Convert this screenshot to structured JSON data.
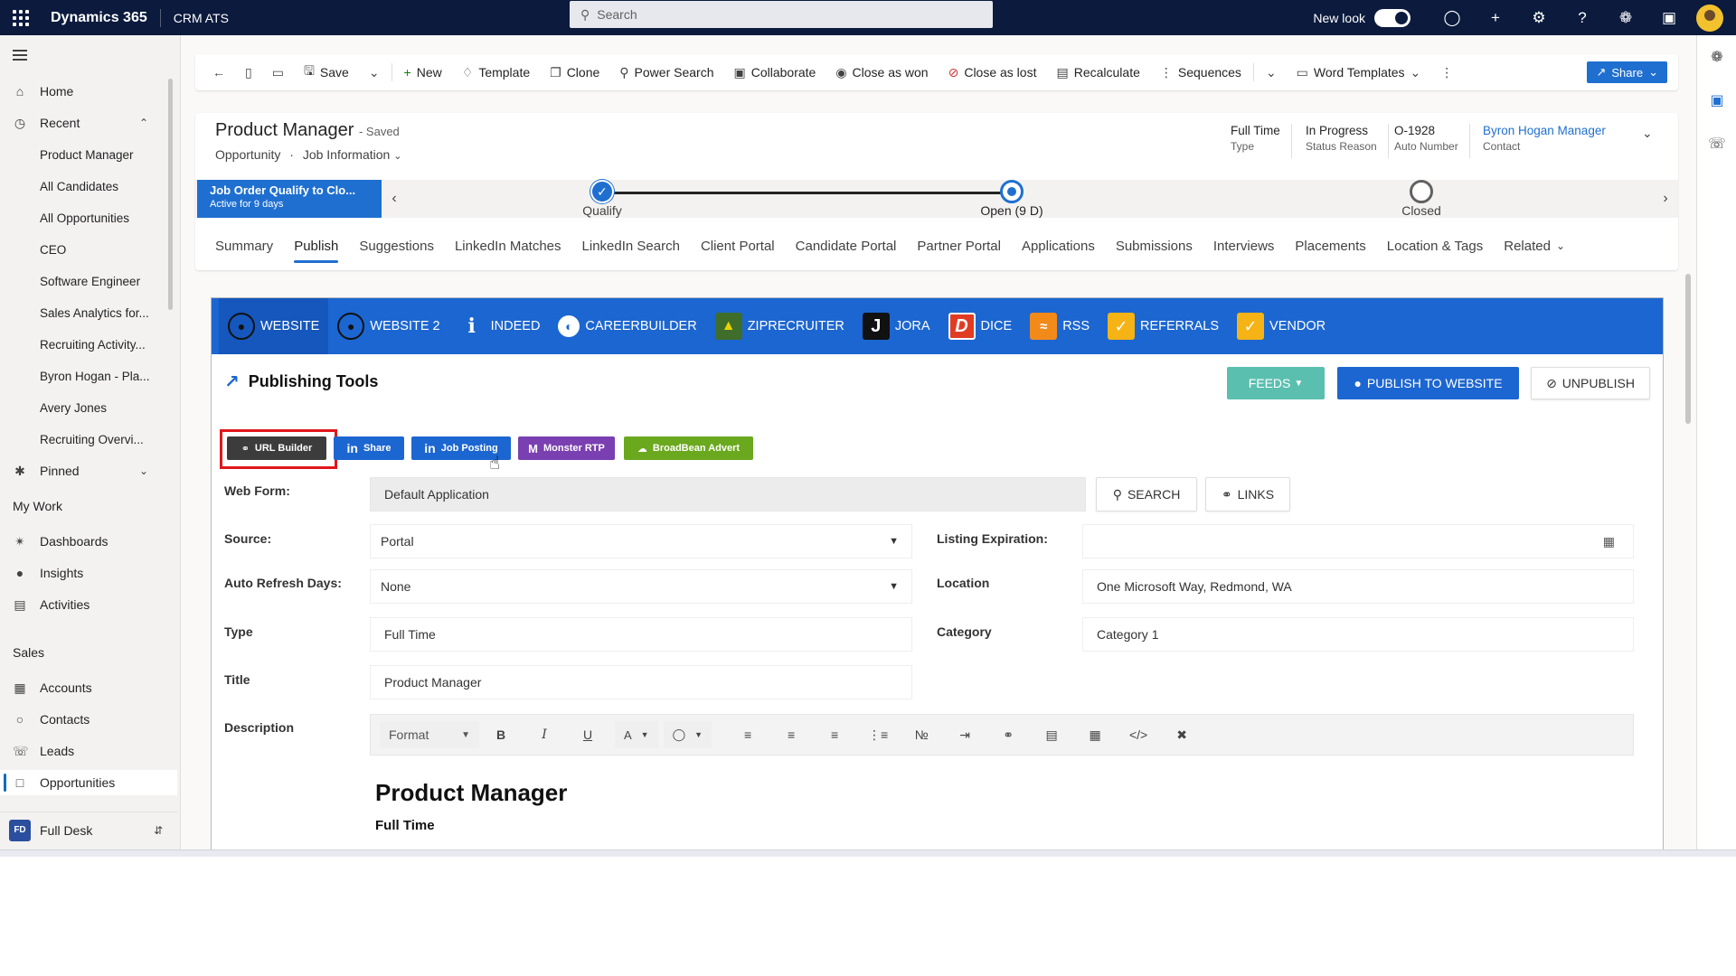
{
  "topbar": {
    "app_name": "Dynamics 365",
    "app_sub": "CRM ATS",
    "search_placeholder": "Search",
    "new_look_label": "New look"
  },
  "nav": {
    "home": "Home",
    "recent": "Recent",
    "recent_items": [
      "Product Manager",
      "All Candidates",
      "All Opportunities",
      "CEO",
      "Software Engineer",
      "Sales Analytics for...",
      "Recruiting Activity...",
      "Byron Hogan - Pla...",
      "Avery Jones",
      "Recruiting Overvi..."
    ],
    "pinned": "Pinned",
    "my_work": "My Work",
    "dashboards": "Dashboards",
    "insights": "Insights",
    "activities": "Activities",
    "sales": "Sales",
    "accounts": "Accounts",
    "contacts": "Contacts",
    "leads": "Leads",
    "opportunities": "Opportunities",
    "area_badge": "FD",
    "area_name": "Full Desk"
  },
  "commands": {
    "save": "Save",
    "new": "New",
    "template": "Template",
    "clone": "Clone",
    "power_search": "Power Search",
    "collaborate": "Collaborate",
    "close_won": "Close as won",
    "close_lost": "Close as lost",
    "recalculate": "Recalculate",
    "sequences": "Sequences",
    "word_templates": "Word Templates",
    "share": "Share"
  },
  "record": {
    "title": "Product Manager",
    "saved": "- Saved",
    "entity": "Opportunity",
    "form": "Job Information",
    "fields": [
      {
        "value": "Full Time",
        "label": "Type"
      },
      {
        "value": "In Progress",
        "label": "Status Reason"
      },
      {
        "value": "O-1928",
        "label": "Auto Number"
      },
      {
        "value": "Byron Hogan Manager",
        "label": "Contact"
      }
    ]
  },
  "bpf": {
    "active_title": "Job Order Qualify to Clo...",
    "active_sub": "Active for 9 days",
    "stages": [
      {
        "name": "Qualify",
        "state": "done"
      },
      {
        "name": "Open  (9 D)",
        "state": "current"
      },
      {
        "name": "Closed",
        "state": "future"
      }
    ]
  },
  "tabs": [
    "Summary",
    "Publish",
    "Suggestions",
    "LinkedIn Matches",
    "LinkedIn Search",
    "Client Portal",
    "Candidate Portal",
    "Partner Portal",
    "Applications",
    "Submissions",
    "Interviews",
    "Placements",
    "Location & Tags",
    "Related"
  ],
  "active_tab": "Publish",
  "channels": [
    "WEBSITE",
    "WEBSITE 2",
    "INDEED",
    "CAREERBUILDER",
    "ZIPRECRUITER",
    "JORA",
    "DICE",
    "RSS",
    "REFERRALS",
    "VENDOR"
  ],
  "publishing": {
    "title": "Publishing Tools",
    "feeds": "FEEDS",
    "publish": "PUBLISH TO WEBSITE",
    "unpublish": "UNPUBLISH",
    "tools": {
      "url_builder": "URL Builder",
      "share": "Share",
      "job_posting": "Job Posting",
      "monster": "Monster RTP",
      "broadbean": "BroadBean Advert"
    },
    "search": "SEARCH",
    "links": "LINKS"
  },
  "form": {
    "web_form_label": "Web Form:",
    "web_form_value": "Default Application",
    "source_label": "Source:",
    "source_value": "Portal",
    "listing_exp_label": "Listing Expiration:",
    "auto_refresh_label": "Auto Refresh Days:",
    "auto_refresh_value": "None",
    "location_label": "Location",
    "location_value": "One Microsoft Way, Redmond, WA",
    "type_label": "Type",
    "type_value": "Full Time",
    "category_label": "Category",
    "category_value": "Category 1",
    "title_label": "Title",
    "title_value": "Product Manager",
    "description_label": "Description",
    "format_label": "Format",
    "editor_heading": "Product Manager",
    "editor_sub": "Full Time"
  },
  "colors": {
    "topbar": "#0b1a3d",
    "channel_bar": "#1c66d1",
    "highlight": "#e0161b"
  }
}
